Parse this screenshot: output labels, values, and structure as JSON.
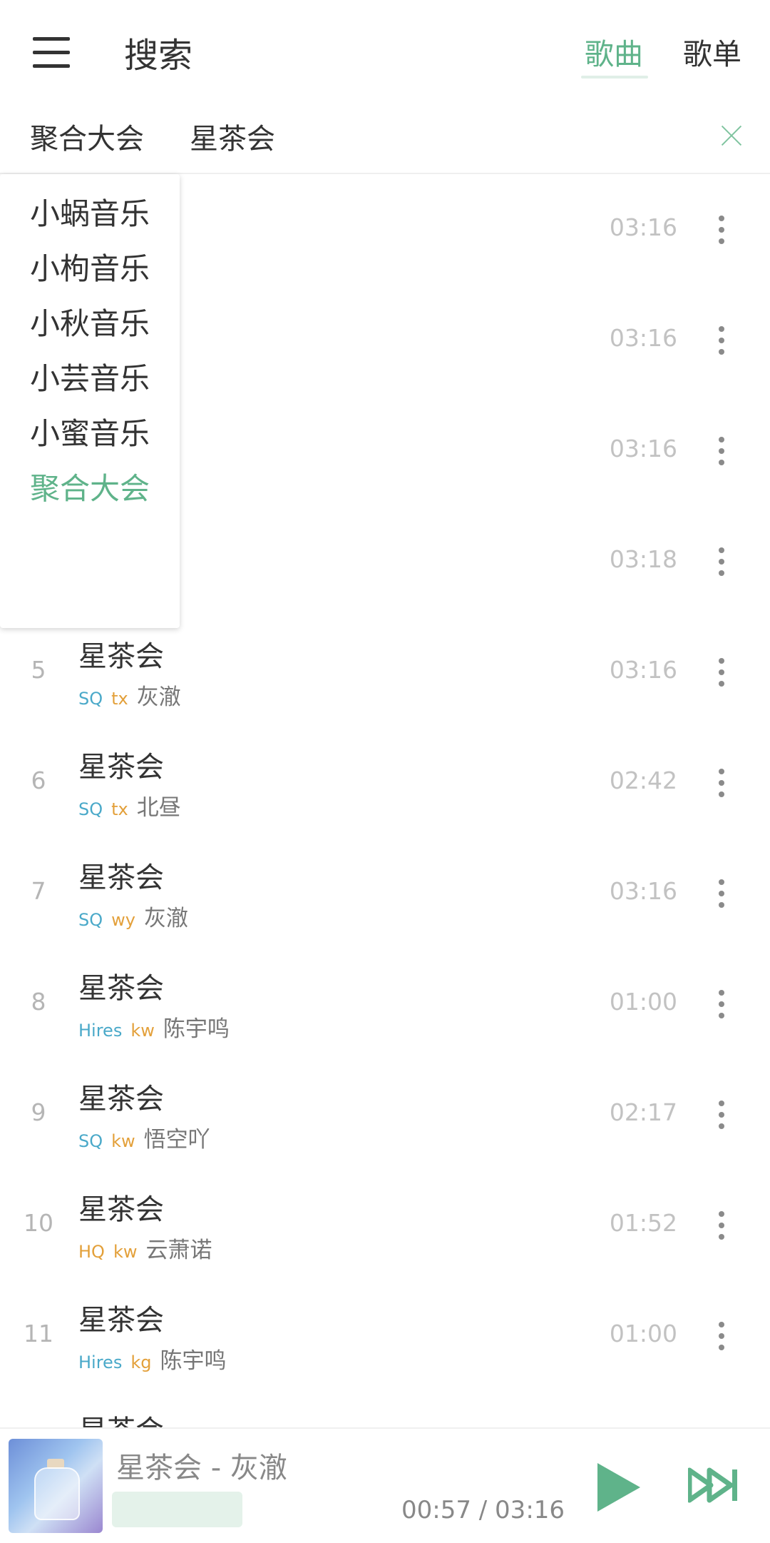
{
  "header": {
    "title": "搜索",
    "tabs": [
      {
        "label": "歌曲",
        "active": true
      },
      {
        "label": "歌单",
        "active": false
      }
    ],
    "accent_color": "#5fb38a"
  },
  "search": {
    "source": "聚合大会",
    "query": "星茶会"
  },
  "dropdown": {
    "items": [
      "小蜗音乐",
      "小枸音乐",
      "小秋音乐",
      "小芸音乐",
      "小蜜音乐",
      "聚合大会"
    ],
    "selected": "聚合大会"
  },
  "songs": [
    {
      "num": "",
      "title": "",
      "quality": "",
      "source": "",
      "singer": "",
      "duration": "03:16"
    },
    {
      "num": "",
      "title": "",
      "quality": "",
      "source": "",
      "singer": "",
      "duration": "03:16"
    },
    {
      "num": "",
      "title": "",
      "quality": "",
      "source": "",
      "singer": "",
      "duration": "03:16"
    },
    {
      "num": "",
      "title": "",
      "quality": "",
      "source": "",
      "singer": "",
      "duration": "03:18"
    },
    {
      "num": "5",
      "title": "星茶会",
      "quality": "SQ",
      "source": "tx",
      "singer": "灰澈",
      "duration": "03:16"
    },
    {
      "num": "6",
      "title": "星茶会",
      "quality": "SQ",
      "source": "tx",
      "singer": "北昼",
      "duration": "02:42"
    },
    {
      "num": "7",
      "title": "星茶会",
      "quality": "SQ",
      "source": "wy",
      "singer": "灰澈",
      "duration": "03:16"
    },
    {
      "num": "8",
      "title": "星茶会",
      "quality": "Hires",
      "source": "kw",
      "singer": "陈宇鸣",
      "duration": "01:00"
    },
    {
      "num": "9",
      "title": "星茶会",
      "quality": "SQ",
      "source": "kw",
      "singer": "悟空吖",
      "duration": "02:17"
    },
    {
      "num": "10",
      "title": "星茶会",
      "quality": "HQ",
      "source": "kw",
      "singer": "云萧诺",
      "duration": "01:52"
    },
    {
      "num": "11",
      "title": "星茶会",
      "quality": "Hires",
      "source": "kg",
      "singer": "陈宇鸣",
      "duration": "01:00"
    },
    {
      "num": "",
      "title": "星茶会",
      "quality": "",
      "source": "",
      "singer": "",
      "duration": ""
    }
  ],
  "player": {
    "now_playing": "星茶会 - 灰澈",
    "time": "00:57 / 03:16",
    "play_icon": "play-icon",
    "next_icon": "next-icon"
  }
}
